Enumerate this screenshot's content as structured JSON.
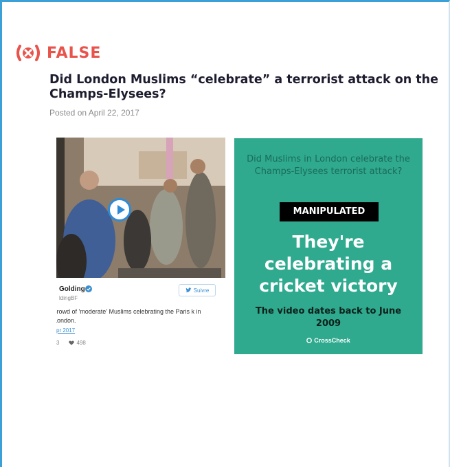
{
  "verdict": {
    "label": "FALSE",
    "icon": "x-badge-icon",
    "color": "#e8534c"
  },
  "article": {
    "headline": "Did London Muslims “celebrate” a terrorist attack on the Champs-Elysees?",
    "posted": "Posted on April 22, 2017"
  },
  "tweet": {
    "video_icon": "play-icon",
    "name": "Golding",
    "handle": "ldingBF",
    "follow_label": "Suivre",
    "text": "crowd of 'moderate' Muslims celebrating the Paris k in London.",
    "date": "pr 2017",
    "retweets": "3",
    "likes": "498"
  },
  "card": {
    "question": "Did Muslims in London celebrate the Champs-Elysees terrorist attack?",
    "tag": "MANIPULATED",
    "headline": "They're celebrating a cricket victory",
    "detail": "The video dates back to June 2009",
    "brand": "CrossCheck",
    "bg_color": "#2faa8e"
  }
}
